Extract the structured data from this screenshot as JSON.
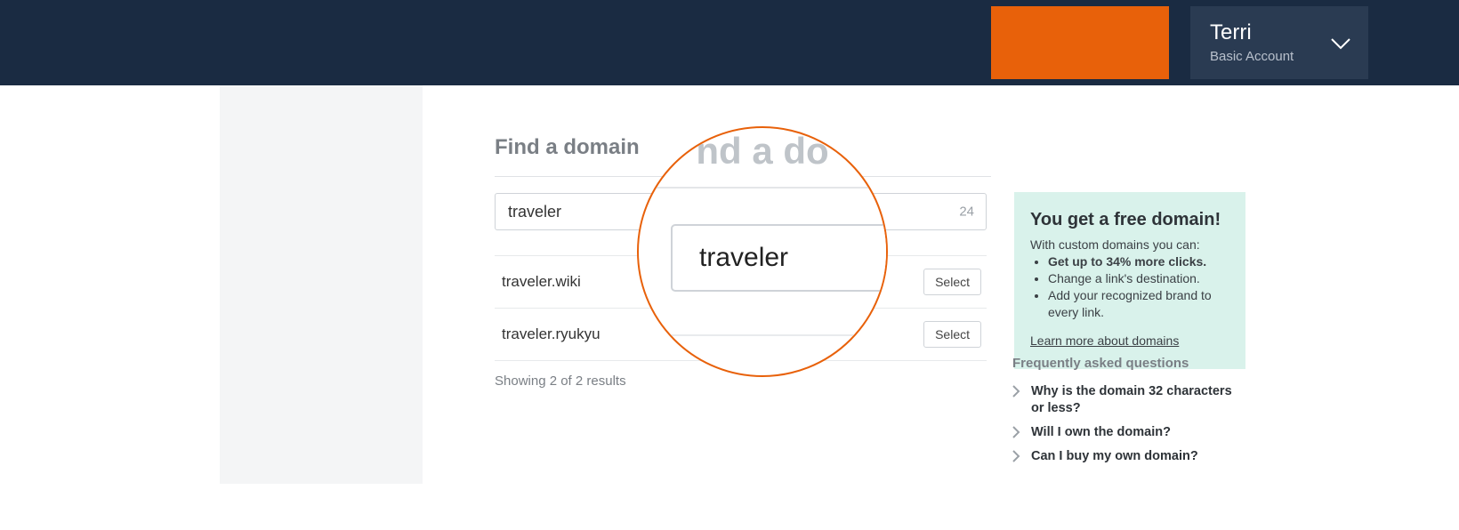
{
  "header": {
    "user_name": "Terri",
    "user_tier": "Basic Account"
  },
  "page": {
    "title": "Find a domain"
  },
  "search": {
    "value": "traveler",
    "remaining": "24"
  },
  "results": {
    "items": [
      {
        "domain": "traveler.wiki",
        "select_label": "Select"
      },
      {
        "domain": "traveler.ryukyu",
        "select_label": "Select"
      }
    ],
    "summary": "Showing 2 of 2 results"
  },
  "promo": {
    "title": "You get a free domain!",
    "lead": "With custom domains you can:",
    "bullets": [
      {
        "text": "Get up to 34% more clicks.",
        "bold": true
      },
      {
        "text": "Change a link's destination.",
        "bold": false
      },
      {
        "text": "Add your recognized brand to every link.",
        "bold": false
      }
    ],
    "link": "Learn more about domains"
  },
  "faq": {
    "title": "Frequently asked questions",
    "items": [
      "Why is the domain 32 characters or less?",
      "Will I own the domain?",
      "Can I buy my own domain?"
    ]
  },
  "magnifier": {
    "title_fragment": "nd a do",
    "value": "traveler"
  }
}
